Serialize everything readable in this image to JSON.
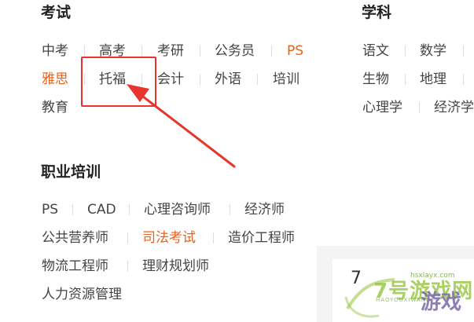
{
  "exam": {
    "title": "考试",
    "links": [
      "中考",
      "高考",
      "考研",
      "公务员",
      "PS",
      "雅思",
      "托福",
      "会计",
      "外语",
      "培训",
      "教育"
    ]
  },
  "subject": {
    "title": "学科",
    "links": [
      "语文",
      "数学",
      "生物",
      "地理",
      "心理学",
      "经济学"
    ]
  },
  "vocational": {
    "title": "职业培训",
    "links": [
      "PS",
      "CAD",
      "心理咨询师",
      "经济师",
      "公共营养师",
      "司法考试",
      "造价工程师",
      "物流工程师",
      "理财规划师",
      "人力资源管理"
    ]
  },
  "panel": {
    "number": "7"
  },
  "watermark": {
    "text": "7号游戏网",
    "sub": "HAOYOUXIWANG",
    "url": "hsxlayx.com",
    "game": "游戏"
  },
  "colors": {
    "highlight": "#e8621a",
    "annotation": "#e8342c",
    "watermark": "#9cc84a"
  }
}
